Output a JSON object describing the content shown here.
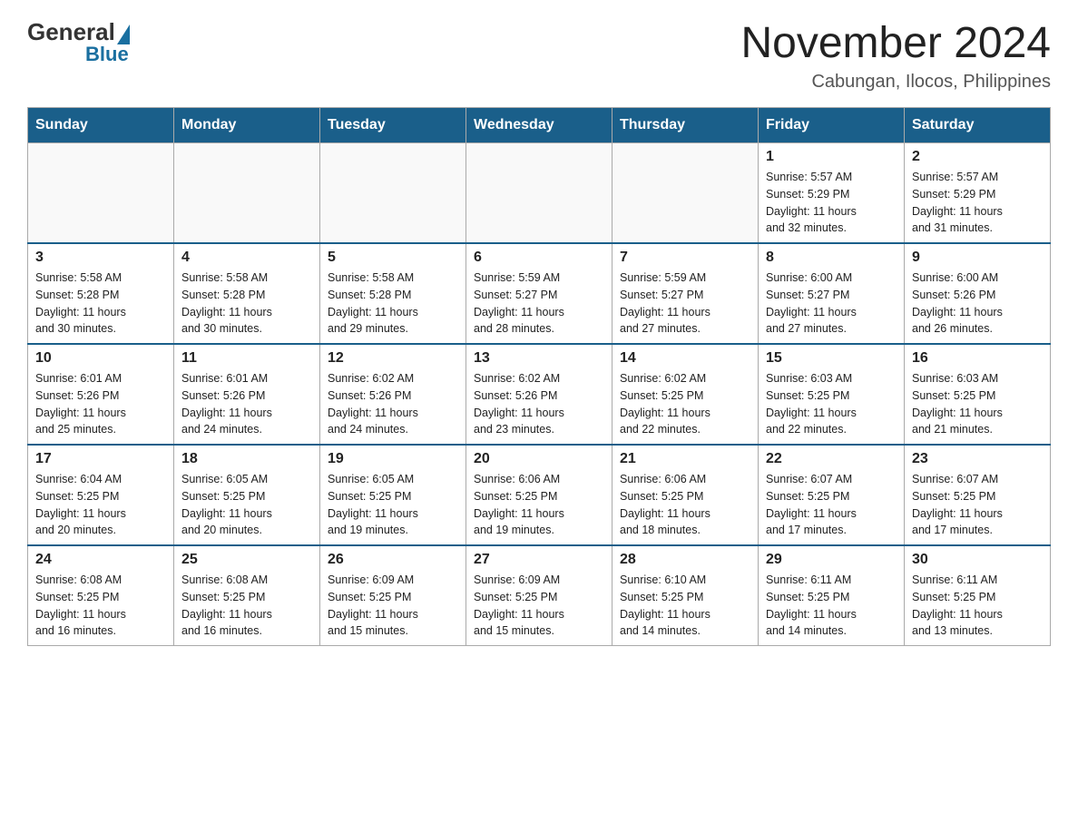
{
  "header": {
    "logo_general": "General",
    "logo_blue": "Blue",
    "title": "November 2024",
    "subtitle": "Cabungan, Ilocos, Philippines"
  },
  "weekdays": [
    "Sunday",
    "Monday",
    "Tuesday",
    "Wednesday",
    "Thursday",
    "Friday",
    "Saturday"
  ],
  "weeks": [
    [
      {
        "day": "",
        "info": ""
      },
      {
        "day": "",
        "info": ""
      },
      {
        "day": "",
        "info": ""
      },
      {
        "day": "",
        "info": ""
      },
      {
        "day": "",
        "info": ""
      },
      {
        "day": "1",
        "info": "Sunrise: 5:57 AM\nSunset: 5:29 PM\nDaylight: 11 hours\nand 32 minutes."
      },
      {
        "day": "2",
        "info": "Sunrise: 5:57 AM\nSunset: 5:29 PM\nDaylight: 11 hours\nand 31 minutes."
      }
    ],
    [
      {
        "day": "3",
        "info": "Sunrise: 5:58 AM\nSunset: 5:28 PM\nDaylight: 11 hours\nand 30 minutes."
      },
      {
        "day": "4",
        "info": "Sunrise: 5:58 AM\nSunset: 5:28 PM\nDaylight: 11 hours\nand 30 minutes."
      },
      {
        "day": "5",
        "info": "Sunrise: 5:58 AM\nSunset: 5:28 PM\nDaylight: 11 hours\nand 29 minutes."
      },
      {
        "day": "6",
        "info": "Sunrise: 5:59 AM\nSunset: 5:27 PM\nDaylight: 11 hours\nand 28 minutes."
      },
      {
        "day": "7",
        "info": "Sunrise: 5:59 AM\nSunset: 5:27 PM\nDaylight: 11 hours\nand 27 minutes."
      },
      {
        "day": "8",
        "info": "Sunrise: 6:00 AM\nSunset: 5:27 PM\nDaylight: 11 hours\nand 27 minutes."
      },
      {
        "day": "9",
        "info": "Sunrise: 6:00 AM\nSunset: 5:26 PM\nDaylight: 11 hours\nand 26 minutes."
      }
    ],
    [
      {
        "day": "10",
        "info": "Sunrise: 6:01 AM\nSunset: 5:26 PM\nDaylight: 11 hours\nand 25 minutes."
      },
      {
        "day": "11",
        "info": "Sunrise: 6:01 AM\nSunset: 5:26 PM\nDaylight: 11 hours\nand 24 minutes."
      },
      {
        "day": "12",
        "info": "Sunrise: 6:02 AM\nSunset: 5:26 PM\nDaylight: 11 hours\nand 24 minutes."
      },
      {
        "day": "13",
        "info": "Sunrise: 6:02 AM\nSunset: 5:26 PM\nDaylight: 11 hours\nand 23 minutes."
      },
      {
        "day": "14",
        "info": "Sunrise: 6:02 AM\nSunset: 5:25 PM\nDaylight: 11 hours\nand 22 minutes."
      },
      {
        "day": "15",
        "info": "Sunrise: 6:03 AM\nSunset: 5:25 PM\nDaylight: 11 hours\nand 22 minutes."
      },
      {
        "day": "16",
        "info": "Sunrise: 6:03 AM\nSunset: 5:25 PM\nDaylight: 11 hours\nand 21 minutes."
      }
    ],
    [
      {
        "day": "17",
        "info": "Sunrise: 6:04 AM\nSunset: 5:25 PM\nDaylight: 11 hours\nand 20 minutes."
      },
      {
        "day": "18",
        "info": "Sunrise: 6:05 AM\nSunset: 5:25 PM\nDaylight: 11 hours\nand 20 minutes."
      },
      {
        "day": "19",
        "info": "Sunrise: 6:05 AM\nSunset: 5:25 PM\nDaylight: 11 hours\nand 19 minutes."
      },
      {
        "day": "20",
        "info": "Sunrise: 6:06 AM\nSunset: 5:25 PM\nDaylight: 11 hours\nand 19 minutes."
      },
      {
        "day": "21",
        "info": "Sunrise: 6:06 AM\nSunset: 5:25 PM\nDaylight: 11 hours\nand 18 minutes."
      },
      {
        "day": "22",
        "info": "Sunrise: 6:07 AM\nSunset: 5:25 PM\nDaylight: 11 hours\nand 17 minutes."
      },
      {
        "day": "23",
        "info": "Sunrise: 6:07 AM\nSunset: 5:25 PM\nDaylight: 11 hours\nand 17 minutes."
      }
    ],
    [
      {
        "day": "24",
        "info": "Sunrise: 6:08 AM\nSunset: 5:25 PM\nDaylight: 11 hours\nand 16 minutes."
      },
      {
        "day": "25",
        "info": "Sunrise: 6:08 AM\nSunset: 5:25 PM\nDaylight: 11 hours\nand 16 minutes."
      },
      {
        "day": "26",
        "info": "Sunrise: 6:09 AM\nSunset: 5:25 PM\nDaylight: 11 hours\nand 15 minutes."
      },
      {
        "day": "27",
        "info": "Sunrise: 6:09 AM\nSunset: 5:25 PM\nDaylight: 11 hours\nand 15 minutes."
      },
      {
        "day": "28",
        "info": "Sunrise: 6:10 AM\nSunset: 5:25 PM\nDaylight: 11 hours\nand 14 minutes."
      },
      {
        "day": "29",
        "info": "Sunrise: 6:11 AM\nSunset: 5:25 PM\nDaylight: 11 hours\nand 14 minutes."
      },
      {
        "day": "30",
        "info": "Sunrise: 6:11 AM\nSunset: 5:25 PM\nDaylight: 11 hours\nand 13 minutes."
      }
    ]
  ]
}
